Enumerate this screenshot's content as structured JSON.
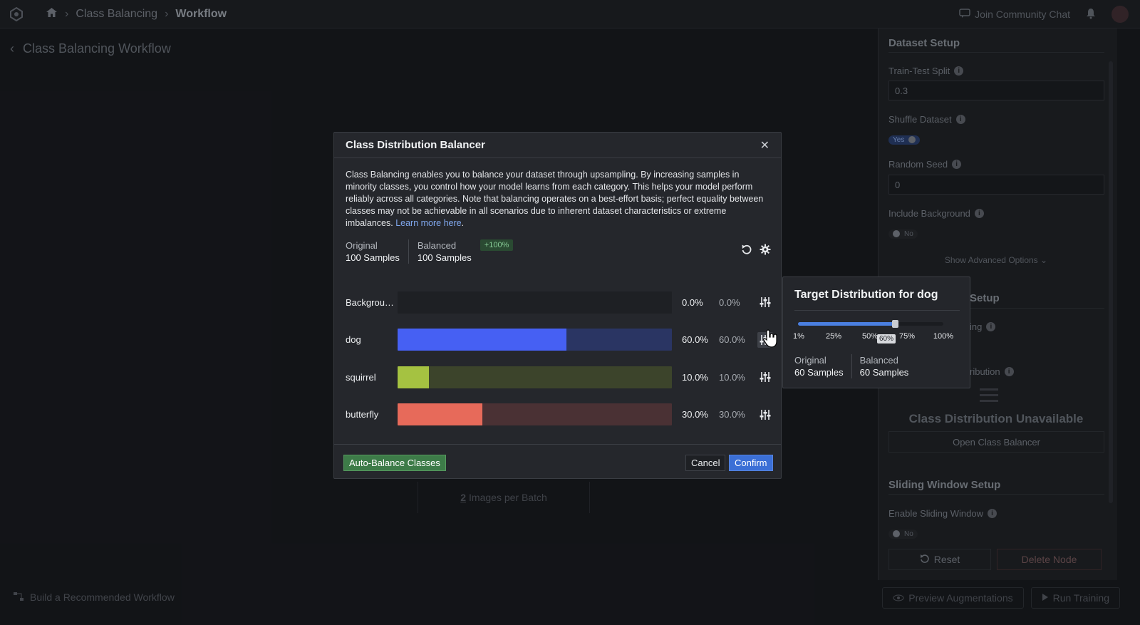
{
  "topbar": {
    "breadcrumb": [
      "Class Balancing",
      "Workflow"
    ],
    "community_label": "Join Community Chat"
  },
  "workflow": {
    "back_title": "Class Balancing Workflow",
    "batch_count": "2",
    "batch_label": "Images per Batch",
    "build_recommended": "Build a Recommended Workflow",
    "preview_aug": "Preview Augmentations",
    "run_training": "Run Training"
  },
  "panel": {
    "dataset_setup": "Dataset Setup",
    "train_test_label": "Train-Test Split",
    "train_test_value": "0.3",
    "shuffle_label": "Shuffle Dataset",
    "shuffle_value": "Yes",
    "seed_label": "Random Seed",
    "seed_value": "0",
    "include_bg_label": "Include Background",
    "include_bg_value": "No",
    "advanced": "Show Advanced Options ⌄",
    "section2_tail": "Setup",
    "ing_label": "ing",
    "dist_label": "ribution",
    "unavailable": "Class Distribution Unavailable",
    "open_balancer": "Open Class Balancer",
    "sliding_title": "Sliding Window Setup",
    "sliding_label": "Enable Sliding Window",
    "sliding_value": "No",
    "reset": "Reset",
    "delete": "Delete Node"
  },
  "modal": {
    "title": "Class Distribution Balancer",
    "description": "Class Balancing enables you to balance your dataset through upsampling. By increasing samples in minority classes, you control how your model learns from each category. This helps your model perform reliably across all categories. Note that balancing operates on a best-effort basis; perfect equality between classes may not be achievable in all scenarios due to inherent dataset characteristics or extreme imbalances.",
    "learn_more": "Learn more here",
    "original_label": "Original",
    "original_value": "100 Samples",
    "balanced_label": "Balanced",
    "balanced_value": "100 Samples",
    "delta_badge": "+100%",
    "classes": [
      {
        "name": "Backgrou…",
        "fraction": 0.0,
        "original": "0.0%",
        "balanced": "0.0%",
        "color": "#3b3e44",
        "track": "#1e2024"
      },
      {
        "name": "dog",
        "fraction": 0.615,
        "original": "60.0%",
        "balanced": "60.0%",
        "color": "#4660f3",
        "track": "#2a3563"
      },
      {
        "name": "squirrel",
        "fraction": 0.115,
        "original": "10.0%",
        "balanced": "10.0%",
        "color": "#a5c241",
        "track": "#3c442b"
      },
      {
        "name": "butterfly",
        "fraction": 0.31,
        "original": "30.0%",
        "balanced": "30.0%",
        "color": "#e76a5a",
        "track": "#4a3134"
      }
    ],
    "auto_balance": "Auto-Balance Classes",
    "cancel": "Cancel",
    "confirm": "Confirm"
  },
  "popover": {
    "title": "Target Distribution for dog",
    "slider_value": 0.6,
    "ticks": [
      "1%",
      "25%",
      "50%",
      "75%",
      "100%"
    ],
    "tooltip": "60%",
    "original_label": "Original",
    "original_value": "60 Samples",
    "balanced_label": "Balanced",
    "balanced_value": "60 Samples"
  }
}
